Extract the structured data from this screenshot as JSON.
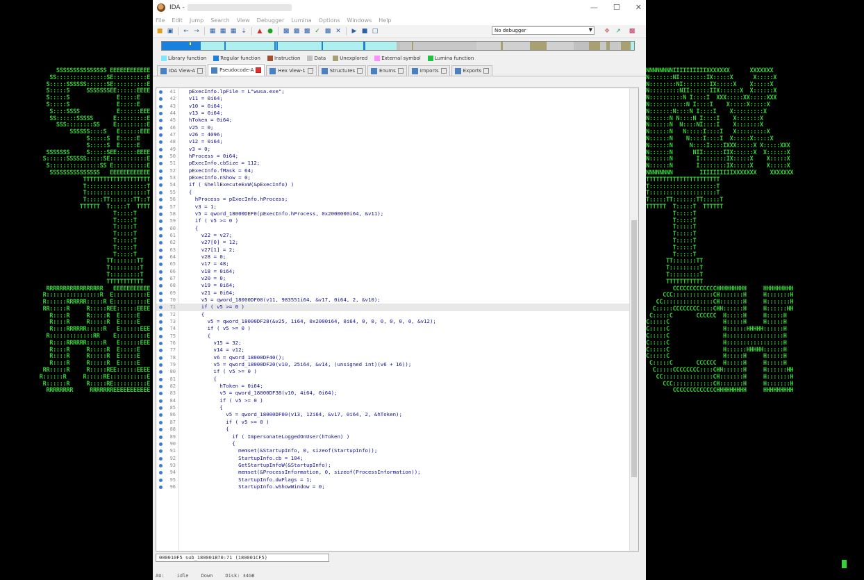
{
  "window": {
    "title": "IDA -",
    "min": "—",
    "max": "☐",
    "close": "✕"
  },
  "menu": [
    "File",
    "Edit",
    "Jump",
    "Search",
    "View",
    "Debugger",
    "Lumina",
    "Options",
    "Windows",
    "Help"
  ],
  "toolbar": {
    "debugger": "No debugger"
  },
  "legend": [
    {
      "label": "Library function",
      "color": "#7fe8ff"
    },
    {
      "label": "Regular function",
      "color": "#1a80e0"
    },
    {
      "label": "Instruction",
      "color": "#a05030"
    },
    {
      "label": "Data",
      "color": "#c0c0c0"
    },
    {
      "label": "Unexplored",
      "color": "#a8a070"
    },
    {
      "label": "External symbol",
      "color": "#ff90ff"
    },
    {
      "label": "Lumina function",
      "color": "#20c040"
    }
  ],
  "tabs": [
    {
      "label": "IDA View-A",
      "active": false
    },
    {
      "label": "Pseudocode-A",
      "active": true
    },
    {
      "label": "Hex View-1",
      "active": false
    },
    {
      "label": "Structures",
      "active": false
    },
    {
      "label": "Enums",
      "active": false
    },
    {
      "label": "Imports",
      "active": false
    },
    {
      "label": "Exports",
      "active": false
    }
  ],
  "code_lines": [
    {
      "n": "41",
      "t": "  pExecInfo.lpFile = L\"wusa.exe\";"
    },
    {
      "n": "42",
      "t": "  v11 = 0i64;"
    },
    {
      "n": "43",
      "t": "  v10 = 0i64;"
    },
    {
      "n": "44",
      "t": "  v13 = 0i64;"
    },
    {
      "n": "45",
      "t": "  hToken = 0i64;"
    },
    {
      "n": "46",
      "t": "  v25 = 0;"
    },
    {
      "n": "47",
      "t": "  v26 = 4096;"
    },
    {
      "n": "48",
      "t": "  v12 = 0i64;"
    },
    {
      "n": "49",
      "t": "  v3 = 0;"
    },
    {
      "n": "50",
      "t": "  hProcess = 0i64;"
    },
    {
      "n": "51",
      "t": "  pExecInfo.cbSize = 112;"
    },
    {
      "n": "52",
      "t": "  pExecInfo.fMask = 64;"
    },
    {
      "n": "53",
      "t": "  pExecInfo.nShow = 0;"
    },
    {
      "n": "54",
      "t": "  if ( ShellExecuteExW(&pExecInfo) )"
    },
    {
      "n": "55",
      "t": "  {"
    },
    {
      "n": "56",
      "t": "    hProcess = pExecInfo.hProcess;"
    },
    {
      "n": "57",
      "t": "    v3 = 1;"
    },
    {
      "n": "58",
      "t": "    v5 = qword_18000DEF0(pExecInfo.hProcess, 0x2000000i64, &v11);"
    },
    {
      "n": "59",
      "t": "    if ( v5 >= 0 )"
    },
    {
      "n": "60",
      "t": "    {"
    },
    {
      "n": "61",
      "t": "      v22 = v27;"
    },
    {
      "n": "62",
      "t": "      v27[0] = 12;"
    },
    {
      "n": "63",
      "t": "      v27[1] = 2;"
    },
    {
      "n": "64",
      "t": "      v28 = 0;"
    },
    {
      "n": "65",
      "t": "      v17 = 48;"
    },
    {
      "n": "66",
      "t": "      v18 = 0i64;"
    },
    {
      "n": "67",
      "t": "      v20 = 0;"
    },
    {
      "n": "68",
      "t": "      v19 = 0i64;"
    },
    {
      "n": "69",
      "t": "      v21 = 0i64;"
    },
    {
      "n": "70",
      "t": "      v5 = qword_18000DF00(v11, 983551i64, &v17, 0i64, 2, &v10);"
    },
    {
      "n": "71",
      "t": "      if ( v5 >= 0 )"
    },
    {
      "n": "72",
      "t": "      {"
    },
    {
      "n": "73",
      "t": "        v5 = qword_18000DF28(&v25, 1i64, 0x2000i64, 0i64, 0, 0, 0, 0, 0, 0, &v12);"
    },
    {
      "n": "74",
      "t": "        if ( v5 >= 0 )"
    },
    {
      "n": "75",
      "t": "        {"
    },
    {
      "n": "76",
      "t": "          v15 = 32;"
    },
    {
      "n": "77",
      "t": "          v14 = v12;"
    },
    {
      "n": "78",
      "t": "          v6 = qword_18000DF40();"
    },
    {
      "n": "79",
      "t": "          v5 = qword_18000DF20(v10, 25i64, &v14, (unsigned int)(v6 + 16));"
    },
    {
      "n": "80",
      "t": "          if ( v5 >= 0 )"
    },
    {
      "n": "81",
      "t": "          {"
    },
    {
      "n": "82",
      "t": "            hToken = 0i64;"
    },
    {
      "n": "83",
      "t": "            v5 = qword_18000DF38(v10, 4i64, 0i64);"
    },
    {
      "n": "84",
      "t": "            if ( v5 >= 0 )"
    },
    {
      "n": "85",
      "t": "            {"
    },
    {
      "n": "86",
      "t": "              v5 = qword_18000DF00(v13, 12i64, &v17, 0i64, 2, &hToken);"
    },
    {
      "n": "87",
      "t": "              if ( v5 >= 0 )"
    },
    {
      "n": "88",
      "t": "              {"
    },
    {
      "n": "89",
      "t": "                if ( ImpersonateLoggedOnUser(hToken) )"
    },
    {
      "n": "90",
      "t": "                {"
    },
    {
      "n": "91",
      "t": "                  memset(&StartupInfo, 0, sizeof(StartupInfo));"
    },
    {
      "n": "92",
      "t": "                  StartupInfo.cb = 104;"
    },
    {
      "n": "93",
      "t": "                  GetStartupInfoW(&StartupInfo);"
    },
    {
      "n": "94",
      "t": "                  memset(&ProcessInformation, 0, sizeof(ProcessInformation));"
    },
    {
      "n": "95",
      "t": "                  StartupInfo.dwFlags = 1;"
    },
    {
      "n": "96",
      "t": "                  StartupInfo.wShowWindow = 0;"
    }
  ],
  "highlight_line": "71",
  "status": {
    "location": "000010F5 sub_180001B70:71 (180001CF5)"
  },
  "bottom": {
    "au": "AU:",
    "idle": "idle",
    "down": "Down",
    "disk": "Disk: 34GB"
  },
  "ascii_left": "SSSSSSSSSSSSSSS EEEEEEEEEEEE\nSS:::::::::::::::SE::::::::::E\nS:::::SSSSSS::::::SE::::::::::E\nS:::::S     SSSSSSSEE::::::EEEE\nS:::::S              E:::::E   \nS:::::S              E:::::E   \n S::::SSSS           E::::::EEE\n  SS::::::SSSSS      E:::::::::E\n    SSS::::::::SS    E:::::::::E\n       SSSSSS::::S   E::::::EEE\n            S:::::S  E:::::E   \n            S:::::S  E:::::E   \nSSSSSSS     S:::::SEE::::::EEEE\nS::::::SSSSSS:::::SE:::::::::::E\nS:::::::::::::::SS E::::::::::E\n SSSSSSSSSSSSSSS   EEEEEEEEEEEE\n          TTTTTTTTTTTTTTTTTTTT\n          T::::::::::::::::::T\n          T::::::::::::::::::T\n          T:::::TT:::::::TT::T\n          TTTTTT  T:::::T  TTTT\n                  T:::::T    \n                  T:::::T    \n                  T:::::T    \n                  T:::::T    \n                  T:::::T    \n                  T:::::T    \n                  T:::::T    \n                TT:::::::TT  \n                T:::::::::T  \n                T:::::::::T  \n                TTTTTTTTTTT  \nRRRRRRRRRRRRRRRRR   EEEEEEEEEEE\nR::::::::::::::::R  E::::::::::E\nR::::::RRRRRR:::::R E::::::::::E\nRR:::::R     R:::::REE::::::EEEE\n  R::::R     R:::::R  E:::::E   \n  R::::R     R:::::R  E:::::E   \n  R::::RRRRRR:::::R   E::::::EEE\n  R:::::::::::::RR    E:::::::::E\n  R::::RRRRRR:::::R   E::::::EEE\n  R::::R     R:::::R  E:::::E   \n  R::::R     R:::::R  E:::::E   \n  R::::R     R:::::R  E:::::E   \nRR:::::R     R:::::REE::::::EEEE\nR::::::R     R:::::RE:::::::::::E\nR::::::R     R:::::RE::::::::::E\nRRRRRRRR     RRRRRRREEEEEEEEEEE",
  "ascii_right": "NNNNNNNNIIIIIIIIIIXXXXXXX      XXXXXXX\nN:::::::NI::::::::IX:::::X      X:::::X\nN::::::::NI::::::::IX:::::X    X:::::X \nN:::::::::NII::::::IIX::::::X  X::::::X \nN::::::::::N I::::I  XXX:::::XX:::::XXX\nN:::::::::::N I::::I    X:::::X:::::X  \nN:::::::N::::N I::::I    X:::::::::X   \nN::::::N N::::N I::::I    X:::::::X    \nN::::::N  N::::NI::::I    X:::::::X    \nN::::::N   N:::::I::::I   X:::::::::X   \nN::::::N    N::::I::::I  X:::::X:::::X  \nN::::::N     N::::I::::IXXX:::::X X:::::XXX\nN::::::N      NII::::::IIX::::::X  X::::::X\nN::::::N       I::::::::IX:::::X    X:::::X\nN::::::N       I::::::::IX:::::X    X:::::X\nNNNNNNNN        IIIIIIIIIIXXXXXXX    XXXXXXX\nTTTTTTTTTTTTTTTTTTTTTT\nT::::::::::::::::::::T\nT::::::::::::::::::::T\nT:::::TT:::::::TT:::::T\nTTTTTT  T:::::T  TTTTTT\n        T:::::T        \n        T:::::T        \n        T:::::T        \n        T:::::T        \n        T:::::T        \n        T:::::T        \n        T:::::T        \n      TT:::::::TT      \n      T:::::::::T      \n      T:::::::::T      \n      TTTTTTTTTTT      \n        CCCCCCCCCCCCCHHHHHHHHH     HHHHHHHHH\n     CCC::::::::::::CH:::::::H     H:::::::H\n   CC:::::::::::::::CH:::::::H     H:::::::H\n  C:::::CCCCCCCC::::CHH::::::H     H::::::HH\n C:::::C       CCCCCC  H:::::H     H:::::H  \nC:::::C                H:::::H     H:::::H  \nC:::::C                H::::::HHHHH::::::H  \nC:::::C                H:::::::::::::::::H  \nC:::::C                H:::::::::::::::::H  \nC:::::C                H::::::HHHHH::::::H  \nC:::::C                H:::::H     H:::::H  \n C:::::C       CCCCCC  H:::::H     H:::::H  \n  C:::::CCCCCCCC::::CHH::::::H     H::::::HH\n   CC:::::::::::::::CH:::::::H     H:::::::H\n     CCC::::::::::::CH:::::::H     H:::::::H\n        CCCCCCCCCCCCCHHHHHHHHH     HHHHHHHHH"
}
